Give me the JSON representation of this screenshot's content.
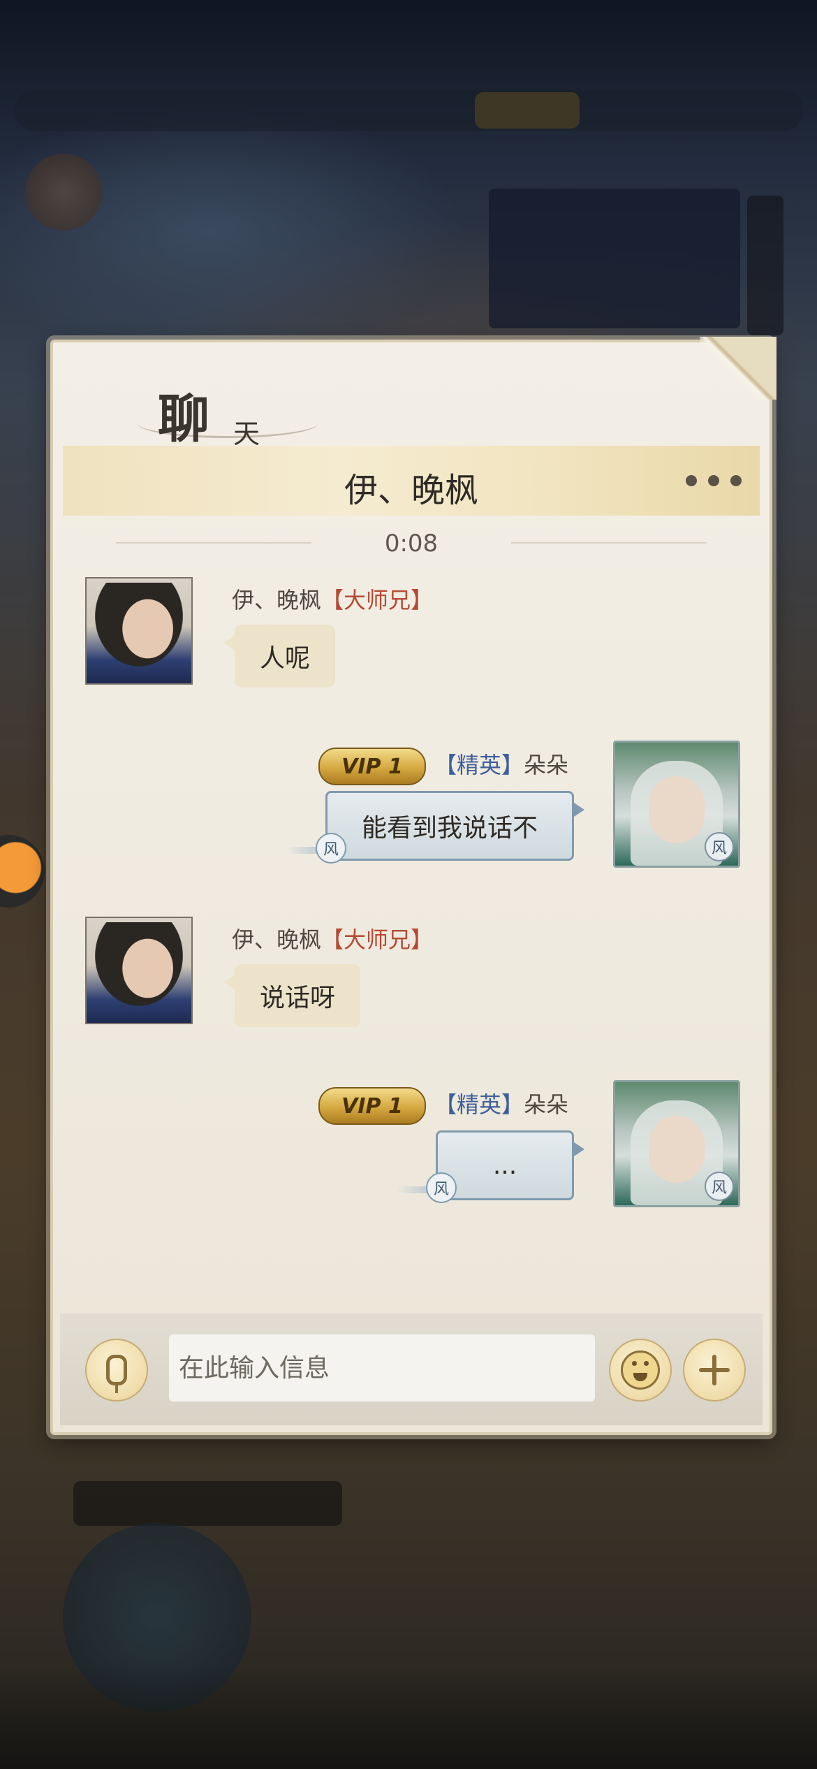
{
  "chat": {
    "header_title_main": "聊",
    "header_title_sub": "天",
    "peer_name": "伊、晚枫",
    "timestamp": "0:08"
  },
  "messages": [
    {
      "side": "left",
      "sender": "伊、晚枫",
      "title": "【大师兄】",
      "text": "人呢"
    },
    {
      "side": "right",
      "vip": "VIP 1",
      "title": "【精英】",
      "sender": "朵朵",
      "text": "能看到我说话不",
      "tag": "风"
    },
    {
      "side": "left",
      "sender": "伊、晚枫",
      "title": "【大师兄】",
      "text": "说话呀"
    },
    {
      "side": "right",
      "vip": "VIP 1",
      "title": "【精英】",
      "sender": "朵朵",
      "text": "...",
      "tag": "风"
    }
  ],
  "input": {
    "placeholder": "在此输入信息"
  },
  "colors": {
    "title_red": "#b54a33",
    "title_blue": "#3f5f9b",
    "panel_bg": "#f3efe6",
    "peer_bar": "#f5ebd0"
  }
}
